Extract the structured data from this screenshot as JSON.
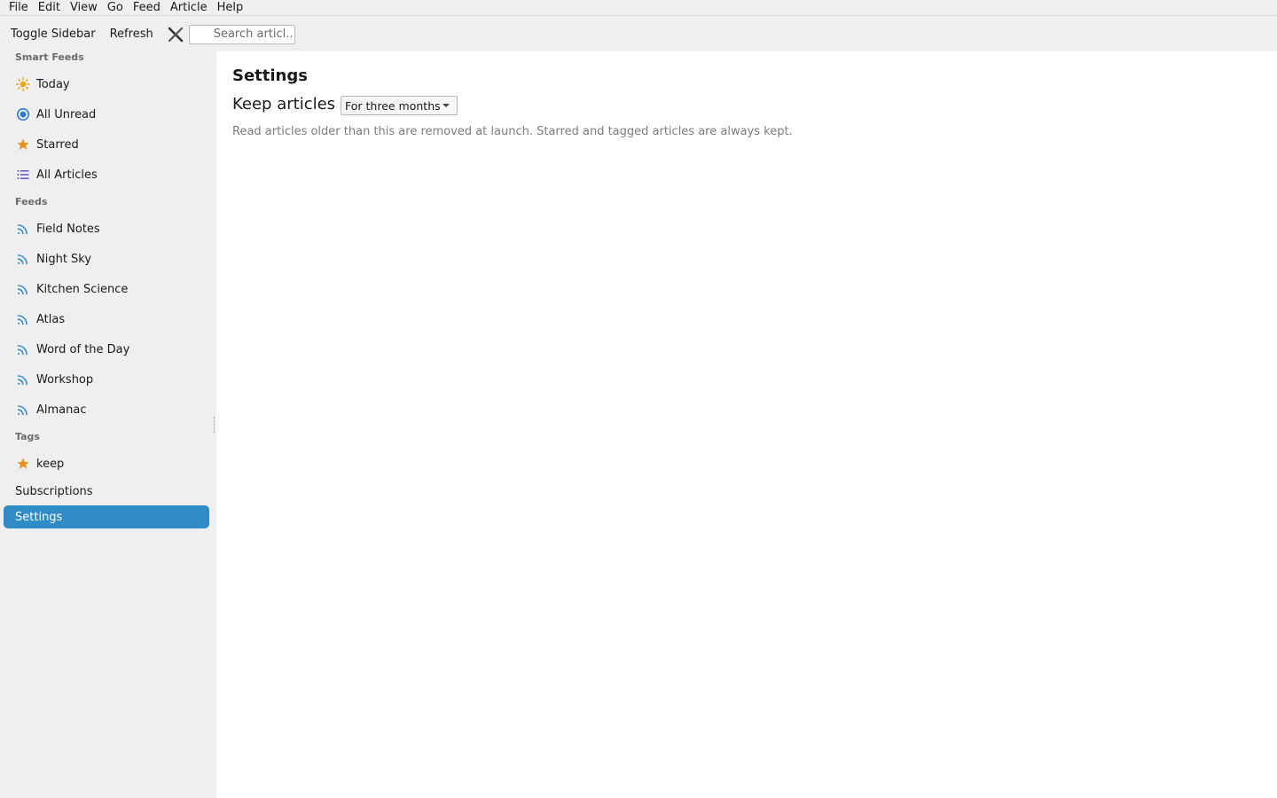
{
  "menubar": {
    "items": [
      "File",
      "Edit",
      "View",
      "Go",
      "Feed",
      "Article",
      "Help"
    ]
  },
  "toolbar": {
    "toggle_sidebar": "Toggle Sidebar",
    "refresh": "Refresh",
    "close_icon": "close-icon",
    "search_placeholder": "Search articl..."
  },
  "sidebar": {
    "smart_feeds_title": "Smart Feeds",
    "smart_feeds": [
      {
        "label": "Today",
        "icon": "sun-icon",
        "color": "#f0a30a"
      },
      {
        "label": "All Unread",
        "icon": "radio-dot-icon",
        "color": "#2a7bd6"
      },
      {
        "label": "Starred",
        "icon": "star-icon",
        "color": "#e8901a"
      },
      {
        "label": "All Articles",
        "icon": "list-icon",
        "color": "#6a5acd"
      }
    ],
    "feeds_title": "Feeds",
    "feeds": [
      {
        "label": "Field Notes",
        "icon": "rss-icon"
      },
      {
        "label": "Night Sky",
        "icon": "rss-icon"
      },
      {
        "label": "Kitchen Science",
        "icon": "rss-icon"
      },
      {
        "label": "Atlas",
        "icon": "rss-icon"
      },
      {
        "label": "Word of the Day",
        "icon": "rss-icon"
      },
      {
        "label": "Workshop",
        "icon": "rss-icon"
      },
      {
        "label": "Almanac",
        "icon": "rss-icon"
      }
    ],
    "tags_title": "Tags",
    "tags": [
      {
        "label": "keep",
        "icon": "star-icon"
      }
    ],
    "subscriptions": "Subscriptions",
    "settings": "Settings",
    "accent_color": "#308cc6"
  },
  "main": {
    "title": "Settings",
    "keep_label": "Keep articles",
    "keep_value": "For three months",
    "hint": "Read articles older than this are removed at launch. Starred and tagged articles are always kept."
  }
}
